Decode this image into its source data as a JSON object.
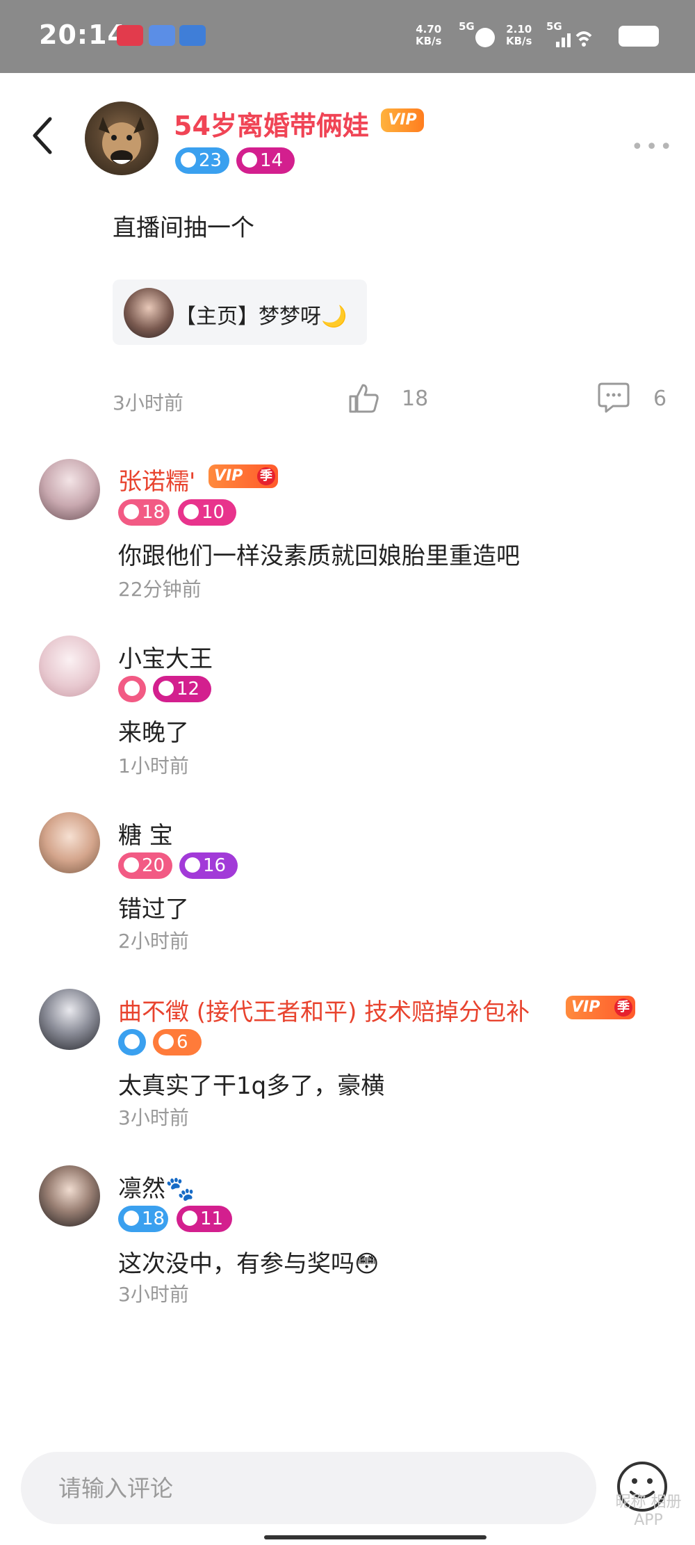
{
  "status_bar": {
    "time": "20:14",
    "net_down": "4.70\nKB/s",
    "net_up": "2.10\nKB/s",
    "signal_1": "5G",
    "signal_2": "5G"
  },
  "post": {
    "author": "54岁离婚带俩娃",
    "vip_label": "VIP",
    "gender_badge": "23",
    "level_badge": "14",
    "text": "直播间抽一个",
    "link_card_label": "【主页】梦梦呀🌙",
    "time": "3小时前",
    "likes": "18",
    "comments": "6"
  },
  "comments": [
    {
      "name": "张诺糯'",
      "name_color": "#e8432e",
      "vip": true,
      "gender": "female",
      "age": "18",
      "level": "10",
      "level_color": "#e8338c",
      "text": "你跟他们一样没素质就回娘胎里重造吧",
      "time": "22分钟前"
    },
    {
      "name": "小宝大王",
      "name_color": "#222222",
      "vip": false,
      "gender": "female",
      "age": "",
      "level": "12",
      "level_color": "#d31f8e",
      "text": "来晚了",
      "time": "1小时前"
    },
    {
      "name": "糖 宝",
      "name_color": "#222222",
      "vip": false,
      "gender": "female",
      "age": "20",
      "level": "16",
      "level_color": "#a23ad8",
      "text": "错过了",
      "time": "2小时前"
    },
    {
      "name": "曲不徵 (接代王者和平) 技术赔掉分包补",
      "name_color": "#e8432e",
      "vip": true,
      "gender": "male",
      "age": "",
      "level": "6",
      "level_color": "#ff7b3a",
      "text": "太真实了干1q多了，豪横",
      "time": "3小时前"
    },
    {
      "name": "凛然🐾",
      "name_color": "#222222",
      "vip": false,
      "gender": "male",
      "age": "18",
      "level": "11",
      "level_color": "#d31f8e",
      "text": "这次没中，有参与奖吗😳",
      "time": "3小时前"
    }
  ],
  "season_tag": "季",
  "input": {
    "placeholder": "请输入评论"
  },
  "watermark": "昵称 相册APP",
  "colors": {
    "accent_red": "#f04455",
    "male_blue": "#3aa0ef",
    "female_pink": "#f25a84",
    "vip_orange": "#ff6a2b"
  },
  "icons": [
    "back-arrow-icon",
    "more-dots-icon",
    "thumbs-up-icon",
    "comment-bubble-icon",
    "emoji-face-icon"
  ]
}
